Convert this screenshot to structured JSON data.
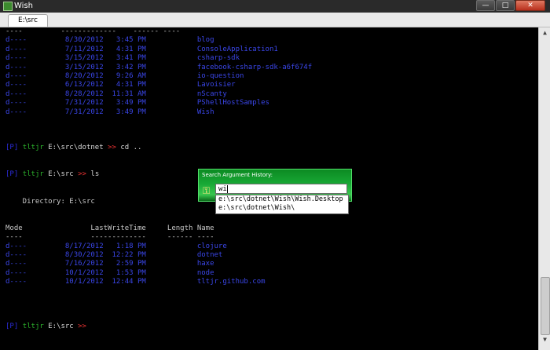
{
  "window": {
    "title": "Wish",
    "minimize": "—",
    "maximize": "□",
    "close": "✕"
  },
  "tab": {
    "label": "E:\\src"
  },
  "colors": {
    "dir_entry": "#3a46e8",
    "prompt_flag": "#2c2cde",
    "prompt_user": "#2cb22c",
    "prompt_path": "#d8d8d8",
    "prompt_arrow": "#e33",
    "header_text": "#c8c8c8",
    "command_text": "#d8d8d8"
  },
  "console_lines": [
    {
      "segments": [
        {
          "text": "----         -------------    ------ ----",
          "role": "header"
        }
      ]
    },
    {
      "segments": [
        {
          "text": "d----         8/30/2012   3:45 PM            blog",
          "role": "dir"
        }
      ]
    },
    {
      "segments": [
        {
          "text": "d----         7/11/2012   4:31 PM            ConsoleApplication1",
          "role": "dir"
        }
      ]
    },
    {
      "segments": [
        {
          "text": "d----         3/15/2012   3:41 PM            csharp-sdk",
          "role": "dir"
        }
      ]
    },
    {
      "segments": [
        {
          "text": "d----         3/15/2012   3:42 PM            facebook-csharp-sdk-a6f674f",
          "role": "dir"
        }
      ]
    },
    {
      "segments": [
        {
          "text": "d----         8/20/2012   9:26 AM            io-question",
          "role": "dir"
        }
      ]
    },
    {
      "segments": [
        {
          "text": "d----         6/13/2012   4:31 PM            Lavoisier",
          "role": "dir"
        }
      ]
    },
    {
      "segments": [
        {
          "text": "d----         8/28/2012  11:31 AM            nScanty",
          "role": "dir"
        }
      ]
    },
    {
      "segments": [
        {
          "text": "d----         7/31/2012   3:49 PM            PShellHostSamples",
          "role": "dir"
        }
      ]
    },
    {
      "segments": [
        {
          "text": "d----         7/31/2012   3:49 PM            Wish",
          "role": "dir"
        }
      ]
    },
    {
      "segments": []
    },
    {
      "segments": []
    },
    {
      "segments": []
    },
    {
      "segments": [
        {
          "text": "[P] ",
          "role": "flag"
        },
        {
          "text": "tltjr ",
          "role": "user"
        },
        {
          "text": "E:\\src\\dotnet ",
          "role": "path"
        },
        {
          "text": ">> ",
          "role": "arrow"
        },
        {
          "text": "cd ..",
          "role": "cmd"
        }
      ]
    },
    {
      "segments": []
    },
    {
      "segments": []
    },
    {
      "segments": [
        {
          "text": "[P] ",
          "role": "flag"
        },
        {
          "text": "tltjr ",
          "role": "user"
        },
        {
          "text": "E:\\src ",
          "role": "path"
        },
        {
          "text": ">> ",
          "role": "arrow"
        },
        {
          "text": "ls",
          "role": "cmd"
        }
      ]
    },
    {
      "segments": []
    },
    {
      "segments": []
    },
    {
      "segments": [
        {
          "text": "    Directory: E:\\src",
          "role": "header"
        }
      ]
    },
    {
      "segments": []
    },
    {
      "segments": []
    },
    {
      "segments": [
        {
          "text": "Mode                LastWriteTime     Length Name",
          "role": "header"
        }
      ]
    },
    {
      "segments": [
        {
          "text": "----                -------------     ------ ----",
          "role": "header"
        }
      ]
    },
    {
      "segments": [
        {
          "text": "d----         8/17/2012   1:18 PM            clojure",
          "role": "dir"
        }
      ]
    },
    {
      "segments": [
        {
          "text": "d----         8/30/2012  12:22 PM            dotnet",
          "role": "dir"
        }
      ]
    },
    {
      "segments": [
        {
          "text": "d----         7/16/2012   2:59 PM            haxe",
          "role": "dir"
        }
      ]
    },
    {
      "segments": [
        {
          "text": "d----         10/1/2012   1:53 PM            node",
          "role": "dir"
        }
      ]
    },
    {
      "segments": [
        {
          "text": "d----         10/1/2012  12:44 PM            tltjr.github.com",
          "role": "dir"
        }
      ]
    },
    {
      "segments": []
    },
    {
      "segments": []
    },
    {
      "segments": []
    },
    {
      "segments": []
    },
    {
      "segments": [
        {
          "text": "[P] ",
          "role": "flag"
        },
        {
          "text": "tltjr ",
          "role": "user"
        },
        {
          "text": "E:\\src ",
          "role": "path"
        },
        {
          "text": ">> ",
          "role": "arrow"
        }
      ]
    }
  ],
  "history_popup": {
    "title": "Search Argument History:",
    "icon": "key-icon",
    "query": "wi",
    "suggestions": [
      "e:\\src\\dotnet\\Wish\\Wish.Desktop",
      "e:\\src\\dotnet\\Wish\\"
    ]
  },
  "scrollbar": {
    "up": "▲",
    "down": "▼"
  }
}
